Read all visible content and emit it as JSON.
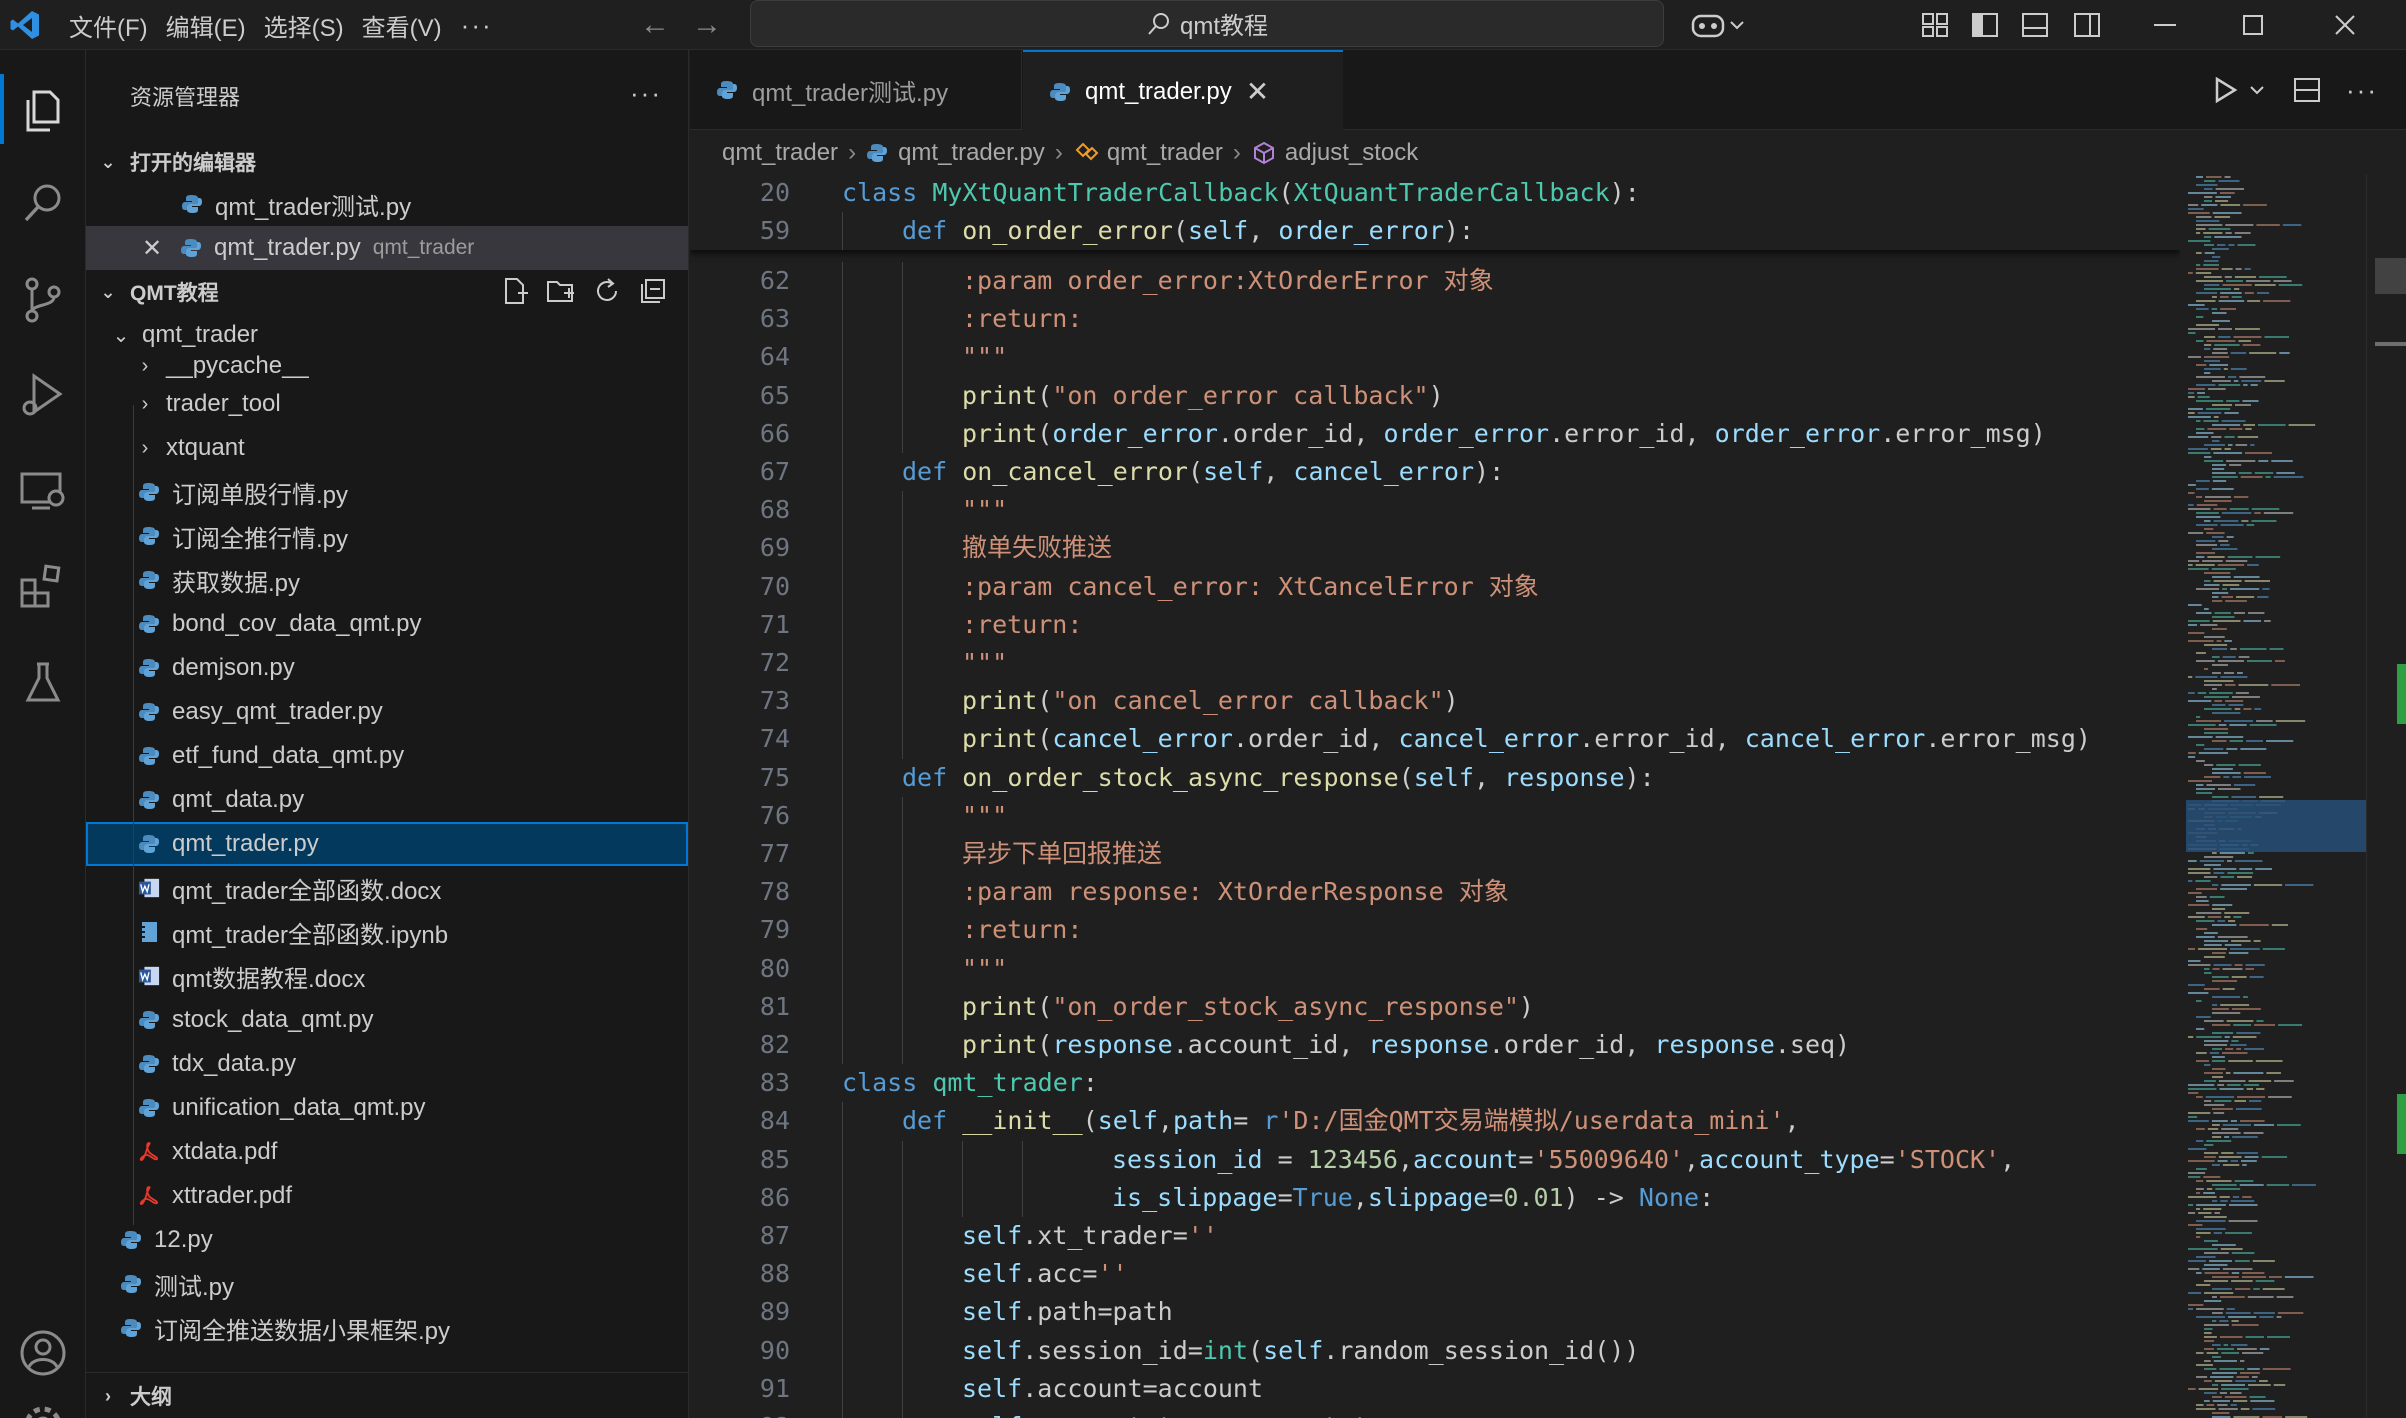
{
  "titlebar": {
    "menu": [
      "文件(F)",
      "编辑(E)",
      "选择(S)",
      "查看(V)"
    ],
    "more": "···",
    "search": "qmt教程"
  },
  "sidebar": {
    "title": "资源管理器",
    "more": "···",
    "open_editors": {
      "label": "打开的编辑器",
      "items": [
        {
          "name": "qmt_trader测试.py"
        },
        {
          "name": "qmt_trader.py",
          "folder": "qmt_trader"
        }
      ]
    },
    "project": {
      "label": "QMT教程",
      "folder": "qmt_trader",
      "children": [
        {
          "name": "__pycache__",
          "type": "folder"
        },
        {
          "name": "trader_tool",
          "type": "folder"
        },
        {
          "name": "xtquant",
          "type": "folder"
        },
        {
          "name": "订阅单股行情.py",
          "type": "py"
        },
        {
          "name": "订阅全推行情.py",
          "type": "py"
        },
        {
          "name": "获取数据.py",
          "type": "py"
        },
        {
          "name": "bond_cov_data_qmt.py",
          "type": "py"
        },
        {
          "name": "demjson.py",
          "type": "py"
        },
        {
          "name": "easy_qmt_trader.py",
          "type": "py"
        },
        {
          "name": "etf_fund_data_qmt.py",
          "type": "py"
        },
        {
          "name": "qmt_data.py",
          "type": "py"
        },
        {
          "name": "qmt_trader.py",
          "type": "py"
        },
        {
          "name": "qmt_trader全部函数.docx",
          "type": "docx"
        },
        {
          "name": "qmt_trader全部函数.ipynb",
          "type": "ipynb"
        },
        {
          "name": "qmt数据教程.docx",
          "type": "docx"
        },
        {
          "name": "stock_data_qmt.py",
          "type": "py"
        },
        {
          "name": "tdx_data.py",
          "type": "py"
        },
        {
          "name": "unification_data_qmt.py",
          "type": "py"
        },
        {
          "name": "xtdata.pdf",
          "type": "pdf"
        },
        {
          "name": "xttrader.pdf",
          "type": "pdf"
        }
      ],
      "root_files": [
        {
          "name": "12.py"
        },
        {
          "name": "测试.py"
        },
        {
          "name": "订阅全推送数据小果框架.py"
        }
      ]
    },
    "outline_label": "大纲"
  },
  "editor": {
    "tabs": [
      {
        "name": "qmt_trader测试.py"
      },
      {
        "name": "qmt_trader.py"
      }
    ],
    "breadcrumb": [
      "qmt_trader",
      "qmt_trader.py",
      "qmt_trader",
      "adjust_stock"
    ],
    "sticky": [
      {
        "n": "20",
        "indent": 0,
        "t": [
          [
            "kw",
            "class "
          ],
          [
            "cls",
            "MyXtQuantTraderCallback"
          ],
          [
            "",
            "("
          ],
          [
            "cls",
            "XtQuantTraderCallback"
          ],
          [
            "",
            "):"
          ]
        ]
      },
      {
        "n": "59",
        "indent": 1,
        "t": [
          [
            "kw",
            "def "
          ],
          [
            "fn",
            "on_order_error"
          ],
          [
            "",
            "("
          ],
          [
            "pa",
            "self"
          ],
          [
            "",
            ", "
          ],
          [
            "pa",
            "order_error"
          ],
          [
            "",
            "):"
          ]
        ]
      }
    ],
    "lines": [
      {
        "n": "62",
        "indent": 2,
        "t": [
          [
            "str",
            ":param order_error:XtOrderError 对象"
          ]
        ]
      },
      {
        "n": "63",
        "indent": 2,
        "t": [
          [
            "str",
            ":return:"
          ]
        ]
      },
      {
        "n": "64",
        "indent": 2,
        "t": [
          [
            "str",
            "\"\"\""
          ]
        ]
      },
      {
        "n": "65",
        "indent": 2,
        "t": [
          [
            "fn",
            "print"
          ],
          [
            "",
            "("
          ],
          [
            "str",
            "\"on order_error callback\""
          ],
          [
            "",
            ")"
          ]
        ]
      },
      {
        "n": "66",
        "indent": 2,
        "t": [
          [
            "fn",
            "print"
          ],
          [
            "",
            "("
          ],
          [
            "pa",
            "order_error"
          ],
          [
            "",
            ".order_id, "
          ],
          [
            "pa",
            "order_error"
          ],
          [
            "",
            ".error_id, "
          ],
          [
            "pa",
            "order_error"
          ],
          [
            "",
            ".error_msg)"
          ]
        ]
      },
      {
        "n": "67",
        "indent": 1,
        "t": [
          [
            "kw",
            "def "
          ],
          [
            "fn",
            "on_cancel_error"
          ],
          [
            "",
            "("
          ],
          [
            "pa",
            "self"
          ],
          [
            "",
            ", "
          ],
          [
            "pa",
            "cancel_error"
          ],
          [
            "",
            "):"
          ]
        ]
      },
      {
        "n": "68",
        "indent": 2,
        "t": [
          [
            "str",
            "\"\"\""
          ]
        ]
      },
      {
        "n": "69",
        "indent": 2,
        "t": [
          [
            "str",
            "撤单失败推送"
          ]
        ]
      },
      {
        "n": "70",
        "indent": 2,
        "t": [
          [
            "str",
            ":param cancel_error: XtCancelError 对象"
          ]
        ]
      },
      {
        "n": "71",
        "indent": 2,
        "t": [
          [
            "str",
            ":return:"
          ]
        ]
      },
      {
        "n": "72",
        "indent": 2,
        "t": [
          [
            "str",
            "\"\"\""
          ]
        ]
      },
      {
        "n": "73",
        "indent": 2,
        "t": [
          [
            "fn",
            "print"
          ],
          [
            "",
            "("
          ],
          [
            "str",
            "\"on cancel_error callback\""
          ],
          [
            "",
            ")"
          ]
        ]
      },
      {
        "n": "74",
        "indent": 2,
        "t": [
          [
            "fn",
            "print"
          ],
          [
            "",
            "("
          ],
          [
            "pa",
            "cancel_error"
          ],
          [
            "",
            ".order_id, "
          ],
          [
            "pa",
            "cancel_error"
          ],
          [
            "",
            ".error_id, "
          ],
          [
            "pa",
            "cancel_error"
          ],
          [
            "",
            ".error_msg)"
          ]
        ]
      },
      {
        "n": "75",
        "indent": 1,
        "t": [
          [
            "kw",
            "def "
          ],
          [
            "fn",
            "on_order_stock_async_response"
          ],
          [
            "",
            "("
          ],
          [
            "pa",
            "self"
          ],
          [
            "",
            ", "
          ],
          [
            "pa",
            "response"
          ],
          [
            "",
            "):"
          ]
        ]
      },
      {
        "n": "76",
        "indent": 2,
        "t": [
          [
            "str",
            "\"\"\""
          ]
        ]
      },
      {
        "n": "77",
        "indent": 2,
        "t": [
          [
            "str",
            "异步下单回报推送"
          ]
        ]
      },
      {
        "n": "78",
        "indent": 2,
        "t": [
          [
            "str",
            ":param response: XtOrderResponse 对象"
          ]
        ]
      },
      {
        "n": "79",
        "indent": 2,
        "t": [
          [
            "str",
            ":return:"
          ]
        ]
      },
      {
        "n": "80",
        "indent": 2,
        "t": [
          [
            "str",
            "\"\"\""
          ]
        ]
      },
      {
        "n": "81",
        "indent": 2,
        "t": [
          [
            "fn",
            "print"
          ],
          [
            "",
            "("
          ],
          [
            "str",
            "\"on_order_stock_async_response\""
          ],
          [
            "",
            ")"
          ]
        ]
      },
      {
        "n": "82",
        "indent": 2,
        "t": [
          [
            "fn",
            "print"
          ],
          [
            "",
            "("
          ],
          [
            "pa",
            "response"
          ],
          [
            "",
            ".account_id, "
          ],
          [
            "pa",
            "response"
          ],
          [
            "",
            ".order_id, "
          ],
          [
            "pa",
            "response"
          ],
          [
            "",
            ".seq)"
          ]
        ]
      },
      {
        "n": "83",
        "indent": 0,
        "t": [
          [
            "kw",
            "class "
          ],
          [
            "cls",
            "qmt_trader"
          ],
          [
            "",
            ":"
          ]
        ]
      },
      {
        "n": "84",
        "indent": 1,
        "t": [
          [
            "kw",
            "def "
          ],
          [
            "fn",
            "__init__"
          ],
          [
            "",
            "("
          ],
          [
            "pa",
            "self"
          ],
          [
            "",
            ","
          ],
          [
            "pa",
            "path"
          ],
          [
            "",
            "= "
          ],
          [
            "kw",
            "r"
          ],
          [
            "str",
            "'D:/国金QMT交易端模拟/userdata_mini'"
          ],
          [
            "",
            ","
          ]
        ]
      },
      {
        "n": "85",
        "indent": 4.5,
        "t": [
          [
            "pa",
            "session_id"
          ],
          [
            "",
            " = "
          ],
          [
            "num",
            "123456"
          ],
          [
            "",
            ","
          ],
          [
            "pa",
            "account"
          ],
          [
            "",
            "="
          ],
          [
            "str",
            "'55009640'"
          ],
          [
            "",
            ","
          ],
          [
            "pa",
            "account_type"
          ],
          [
            "",
            "="
          ],
          [
            "str",
            "'STOCK'"
          ],
          [
            "",
            ","
          ]
        ]
      },
      {
        "n": "86",
        "indent": 4.5,
        "t": [
          [
            "pa",
            "is_slippage"
          ],
          [
            "",
            "="
          ],
          [
            "kw",
            "True"
          ],
          [
            "",
            ","
          ],
          [
            "pa",
            "slippage"
          ],
          [
            "",
            "="
          ],
          [
            "num",
            "0.01"
          ],
          [
            "",
            ") -> "
          ],
          [
            "kw",
            "None"
          ],
          [
            "",
            ":"
          ]
        ]
      },
      {
        "n": "87",
        "indent": 2,
        "t": [
          [
            "pa",
            "self"
          ],
          [
            "",
            ".xt_trader="
          ],
          [
            "str",
            "''"
          ]
        ]
      },
      {
        "n": "88",
        "indent": 2,
        "t": [
          [
            "pa",
            "self"
          ],
          [
            "",
            ".acc="
          ],
          [
            "str",
            "''"
          ]
        ]
      },
      {
        "n": "89",
        "indent": 2,
        "t": [
          [
            "pa",
            "self"
          ],
          [
            "",
            ".path=path"
          ]
        ]
      },
      {
        "n": "90",
        "indent": 2,
        "t": [
          [
            "pa",
            "self"
          ],
          [
            "",
            ".session_id="
          ],
          [
            "cls",
            "int"
          ],
          [
            "",
            "("
          ],
          [
            "pa",
            "self"
          ],
          [
            "",
            ".random_session_id())"
          ]
        ]
      },
      {
        "n": "91",
        "indent": 2,
        "t": [
          [
            "pa",
            "self"
          ],
          [
            "",
            ".account=account"
          ]
        ]
      },
      {
        "n": "92",
        "indent": 2,
        "t": [
          [
            "pa",
            "self"
          ],
          [
            "",
            ".account_type=account_type"
          ]
        ]
      }
    ]
  }
}
